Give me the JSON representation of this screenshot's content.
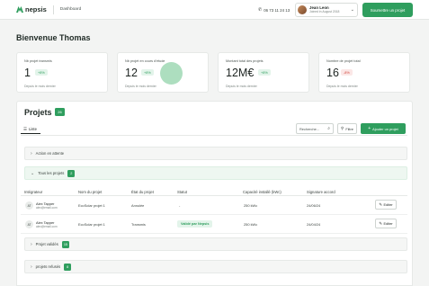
{
  "topbar": {
    "brand": "nepsis",
    "page": "Dashboard",
    "phone": "06 73 11 24 13",
    "user": {
      "name": "Jean Leon",
      "sub": "Joined in August 2018"
    },
    "cta": "Soumettre un projet"
  },
  "welcome": "Bienvenue Thomas",
  "stats": [
    {
      "label": "Nb projet transmis",
      "value": "1",
      "badge": "+8%",
      "trend": "up",
      "since": "Depuis le mois dernier"
    },
    {
      "label": "Nb projet en cours d'étude",
      "value": "12",
      "badge": "+8%",
      "trend": "up",
      "since": "Depuis le mois dernier"
    },
    {
      "label": "Montant total des projets",
      "value": "12M€",
      "badge": "+8%",
      "trend": "up",
      "since": "Depuis le mois dernier"
    },
    {
      "label": "Nombre de projet total",
      "value": "16",
      "badge": "-8%",
      "trend": "down",
      "since": "Depuis le mois dernier"
    }
  ],
  "projects": {
    "title": "Projets",
    "count": "26",
    "tab": "Liste",
    "search_placeholder": "Recherche...",
    "filter_label": "Filtre",
    "add_label": "Ajouter un projet",
    "groups": {
      "pending": {
        "label": "Action en attente"
      },
      "all": {
        "label": "Tous les projets",
        "count": "2"
      },
      "validated": {
        "label": "Projet validés",
        "count": "15"
      },
      "refused": {
        "label": "projets refusés",
        "count": "8"
      }
    },
    "columns": [
      "Intégrateur",
      "Nom du projet",
      "État du projet",
      "Statut",
      "Capacité installé (kWc)",
      "Signature accord"
    ],
    "rows": [
      {
        "initials": "AT",
        "name": "Alex Tapper",
        "email": "alex@email.com",
        "project": "EcoSolar projet 1",
        "state": "Annulée",
        "status": "-",
        "status_pill": false,
        "capacity": "250 kWc",
        "date": "24/06/24",
        "action": "Editer"
      },
      {
        "initials": "AT",
        "name": "Alex Tapper",
        "email": "alex@email.com",
        "project": "EcoSolar projet 1",
        "state": "Transmis",
        "status": "Validé par Nepsis",
        "status_pill": true,
        "capacity": "250 kWc",
        "date": "24/04/24",
        "action": "Editer"
      }
    ]
  },
  "colors": {
    "accent": "#2f9e5e",
    "down": "#d2453b"
  }
}
